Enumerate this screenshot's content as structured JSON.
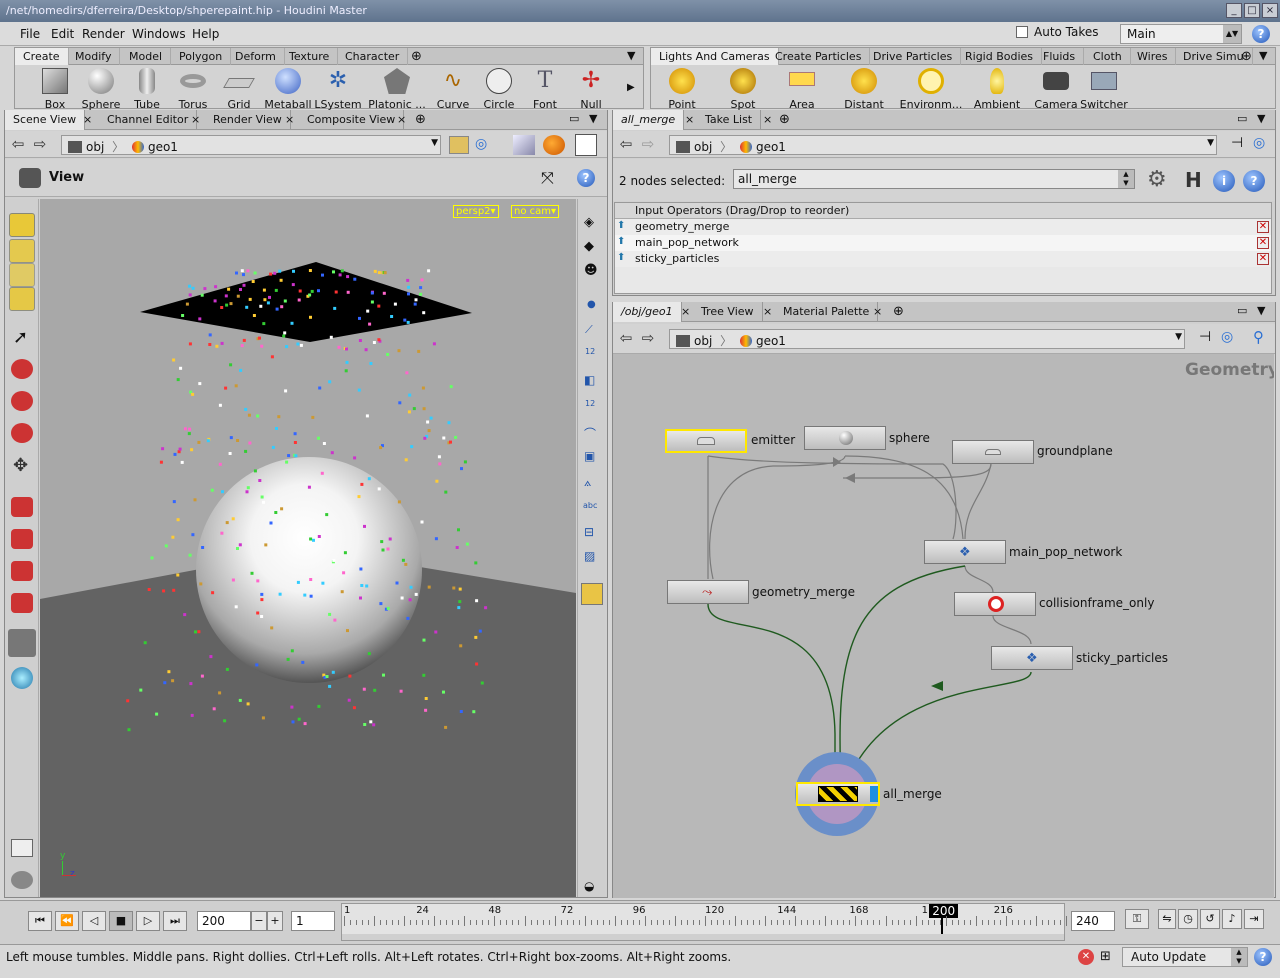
{
  "window": {
    "title": "/net/homedirs/dferreira/Desktop/shperepaint.hip - Houdini Master"
  },
  "menubar": {
    "items": [
      "File",
      "Edit",
      "Render",
      "Windows",
      "Help"
    ],
    "auto_takes": "Auto Takes",
    "take": "Main"
  },
  "shelf_left": {
    "tabs": [
      "Create",
      "Modify",
      "Model",
      "Polygon",
      "Deform",
      "Texture",
      "Character"
    ],
    "tools": [
      "Box",
      "Sphere",
      "Tube",
      "Torus",
      "Grid",
      "Metaball",
      "LSystem",
      "Platonic ...",
      "Curve",
      "Circle",
      "Font",
      "Null"
    ]
  },
  "shelf_right": {
    "tabs": [
      "Lights And Cameras",
      "Create Particles",
      "Drive Particles",
      "Rigid Bodies",
      "Fluids",
      "Cloth",
      "Wires",
      "Drive Simu"
    ],
    "tools": [
      "Point Light",
      "Spot Light",
      "Area Light",
      "Distant Li...",
      "Environm...",
      "Ambient L...",
      "Camera",
      "Switcher"
    ]
  },
  "scene_pane": {
    "tabs": [
      "Scene View",
      "Channel Editor",
      "Render View",
      "Composite View"
    ],
    "path": [
      "obj",
      "geo1"
    ],
    "view_label": "View",
    "camera": "persp2",
    "cam_menu": "no cam",
    "axis_y": "y",
    "axis_z": "z"
  },
  "param_pane": {
    "tabs": [
      "all_merge",
      "Take List"
    ],
    "path": [
      "obj",
      "geo1"
    ],
    "selected_label": "2 nodes selected:",
    "selected_value": "all_merge",
    "table_header": "Input Operators (Drag/Drop to reorder)",
    "rows": [
      "geometry_merge",
      "main_pop_network",
      "sticky_particles"
    ]
  },
  "network_pane": {
    "tabs": [
      "/obj/geo1",
      "Tree View",
      "Material Palette"
    ],
    "path": [
      "obj",
      "geo1"
    ],
    "context_label": "Geometry",
    "nodes": {
      "emitter": "emitter",
      "sphere": "sphere",
      "groundplane": "groundplane",
      "main_pop_network": "main_pop_network",
      "geometry_merge": "geometry_merge",
      "collisionframe_only": "collisionframe_only",
      "sticky_particles": "sticky_particles",
      "all_merge": "all_merge"
    }
  },
  "timeline": {
    "frame": "200",
    "step": "1",
    "ticks": [
      "1",
      "24",
      "48",
      "72",
      "96",
      "120",
      "144",
      "168",
      "1",
      "216"
    ],
    "current": "200",
    "end": "240",
    "playhead_fraction": 0.83
  },
  "status": {
    "message": "Left mouse tumbles. Middle pans. Right dollies. Ctrl+Left rolls. Alt+Left rotates. Ctrl+Right box-zooms. Alt+Right zooms.",
    "update_mode": "Auto Update"
  },
  "colors": {
    "accent_yellow": "#f0e000",
    "selection_blue": "#3b7fd9",
    "wire_green": "#1f5a1f"
  }
}
